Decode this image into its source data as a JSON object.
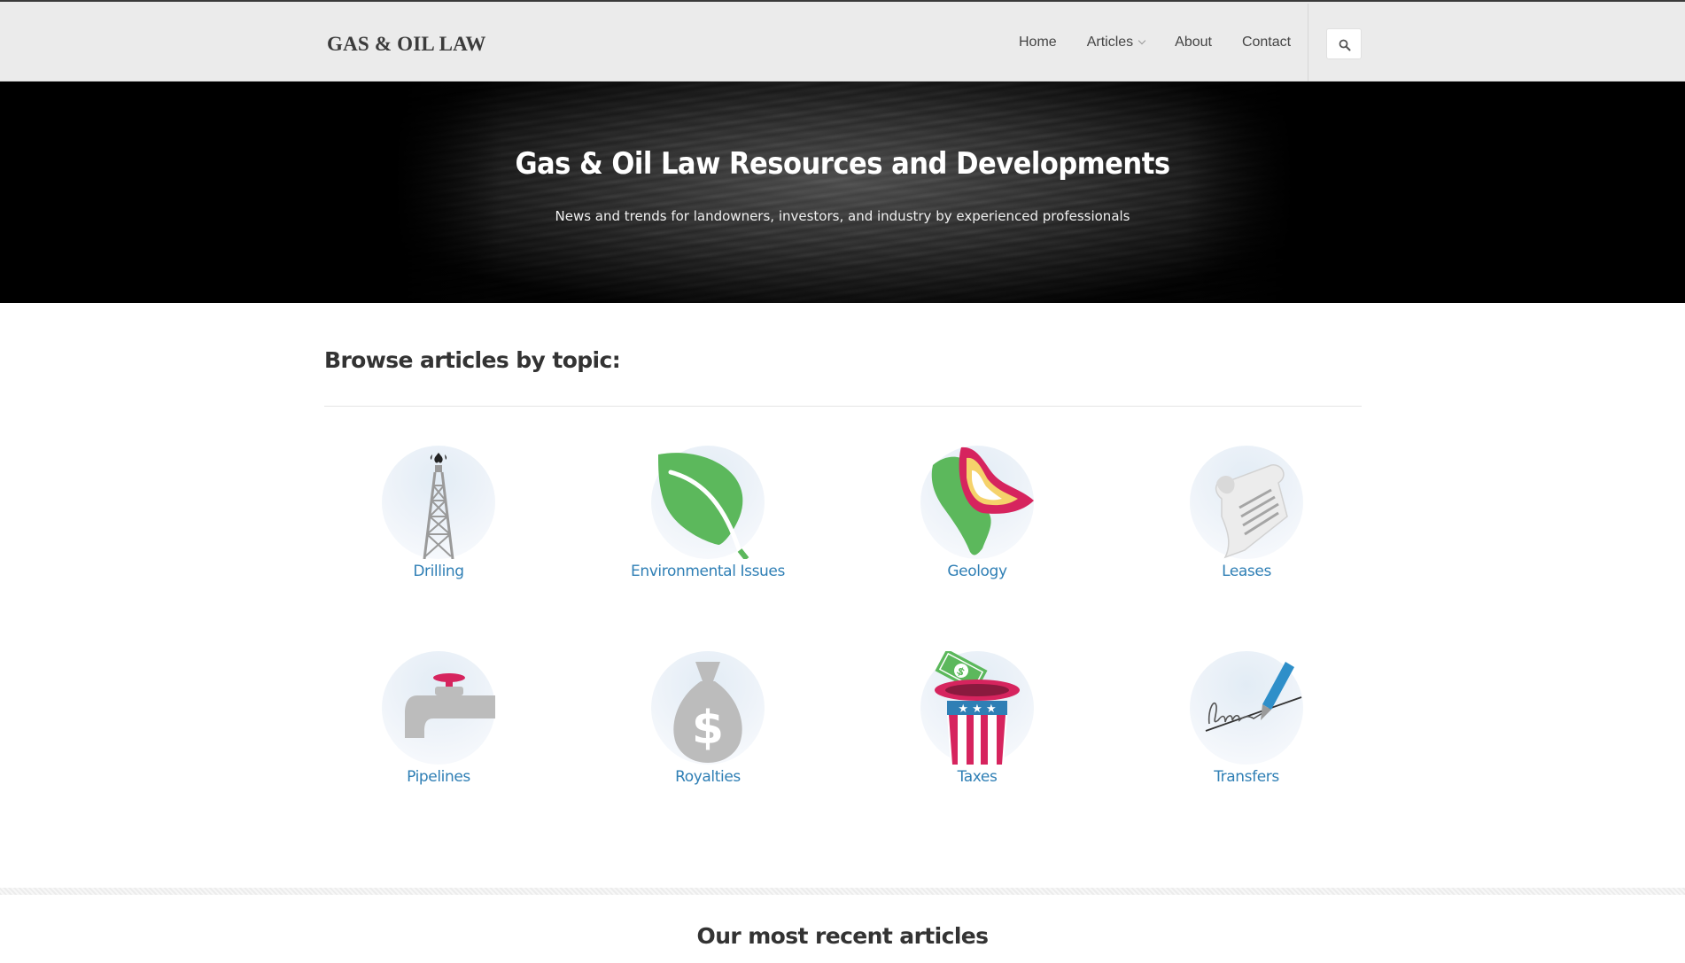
{
  "header": {
    "logo": "GAS & OIL LAW",
    "nav": [
      {
        "label": "Home"
      },
      {
        "label": "Articles",
        "has_dropdown": true
      },
      {
        "label": "About"
      },
      {
        "label": "Contact"
      }
    ],
    "search_icon": "search-icon"
  },
  "hero": {
    "title": "Gas & Oil Law Resources and Developments",
    "subtitle": "News and trends for landowners, investors, and industry by experienced professionals"
  },
  "browse": {
    "title": "Browse articles by topic:",
    "topics": [
      {
        "label": "Drilling",
        "icon": "oil-derrick-icon"
      },
      {
        "label": "Environmental Issues",
        "icon": "leaf-icon"
      },
      {
        "label": "Geology",
        "icon": "map-layers-icon"
      },
      {
        "label": "Leases",
        "icon": "document-scroll-icon"
      },
      {
        "label": "Pipelines",
        "icon": "faucet-icon"
      },
      {
        "label": "Royalties",
        "icon": "money-bag-icon"
      },
      {
        "label": "Taxes",
        "icon": "uncle-sam-hat-icon"
      },
      {
        "label": "Transfers",
        "icon": "pen-signature-icon"
      }
    ]
  },
  "recent": {
    "title": "Our most recent articles"
  },
  "colors": {
    "link": "#2f7fb5",
    "header_bg": "#ebebeb",
    "green": "#5cb85c",
    "pink": "#d6245e",
    "gray_icon": "#9a9a9a"
  }
}
